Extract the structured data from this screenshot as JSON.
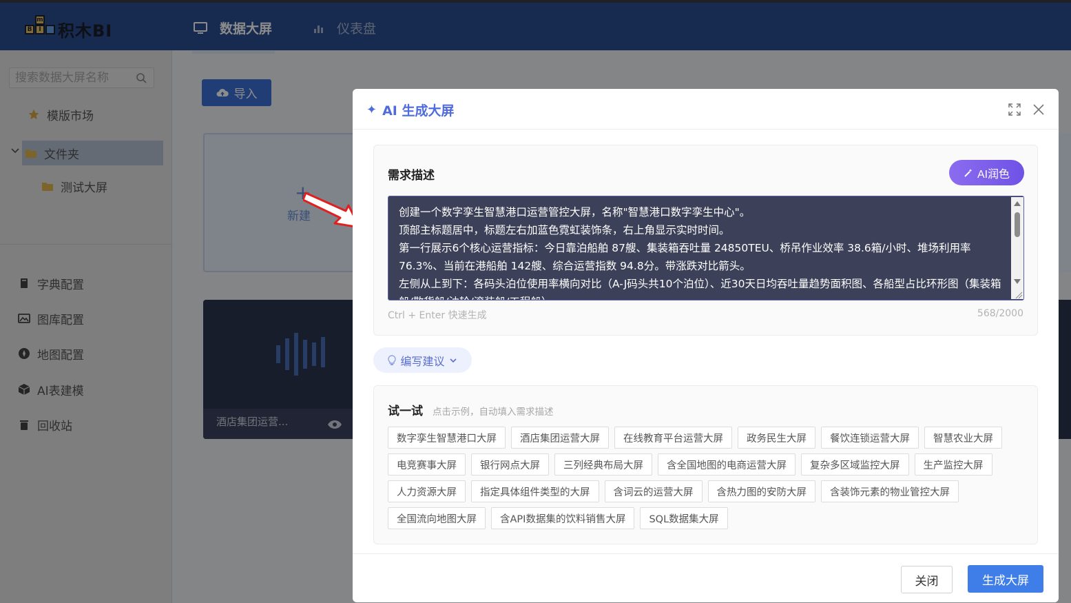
{
  "app": {
    "logo_letters": [
      "m",
      "B",
      "I"
    ],
    "logo_text": "积木BI",
    "nav": [
      {
        "label": "数据大屏",
        "icon": "monitor-icon",
        "active": true
      },
      {
        "label": "仪表盘",
        "icon": "bar-chart-icon",
        "active": false
      }
    ]
  },
  "sidebar": {
    "search_placeholder": "搜索数据大屏名称",
    "template_market": "模版市场",
    "folder": "文件夹",
    "sub_folder": "测试大屏",
    "menu": [
      {
        "label": "字典配置",
        "icon": "book-icon"
      },
      {
        "label": "图库配置",
        "icon": "image-icon"
      },
      {
        "label": "地图配置",
        "icon": "compass-icon"
      },
      {
        "label": "AI表建模",
        "icon": "cube-icon"
      },
      {
        "label": "回收站",
        "icon": "trash-icon"
      }
    ]
  },
  "main": {
    "import_label": "导入",
    "new_label": "新建",
    "new_plus": "+",
    "screen_card_name": "酒店集团运营..."
  },
  "modal": {
    "title": "AI 生成大屏",
    "title_glyph": "✦",
    "requirement": {
      "title": "需求描述",
      "polish_label": "AI润色",
      "text": "创建一个数字孪生智慧港口运营管控大屏，名称\"智慧港口数字孪生中心\"。\n顶部主标题居中，标题左右加蓝色霓虹装饰条，右上角显示实时时间。\n第一行展示6个核心运营指标：今日靠泊船舶 87艘、集装箱吞吐量 24850TEU、桥吊作业效率 38.6箱/小时、堆场利用率 76.3%、当前在港船舶 142艘、综合运营指数 94.8分。带涨跌对比箭头。\n左侧从上到下：各码头泊位使用率横向对比（A-J码头共10个泊位）、近30天日均吞吐量趋势面积图、各船型占比环形图（集装箱船/散货船/油轮/滚装船/工程船）",
      "hint": "Ctrl + Enter 快速生成",
      "counter": "568/2000"
    },
    "suggest_label": "编写建议",
    "try": {
      "title": "试一试",
      "subtitle": "点击示例，自动填入需求描述",
      "tags": [
        "数字孪生智慧港口大屏",
        "酒店集团运营大屏",
        "在线教育平台运营大屏",
        "政务民生大屏",
        "餐饮连锁运营大屏",
        "智慧农业大屏",
        "电竞赛事大屏",
        "银行网点大屏",
        "三列经典布局大屏",
        "含全国地图的电商运营大屏",
        "复杂多区域监控大屏",
        "生产监控大屏",
        "人力资源大屏",
        "指定具体组件类型的大屏",
        "含词云的运营大屏",
        "含热力图的安防大屏",
        "含装饰元素的物业管控大屏",
        "全国流向地图大屏",
        "含API数据集的饮料销售大屏",
        "SQL数据集大屏"
      ]
    },
    "cancel_label": "关闭",
    "generate_label": "生成大屏"
  },
  "colors": {
    "topbar": "#2b4f93",
    "accent": "#3f7ee8",
    "ai_purple": "#7a5cec",
    "title_blue": "#4f6bde"
  }
}
